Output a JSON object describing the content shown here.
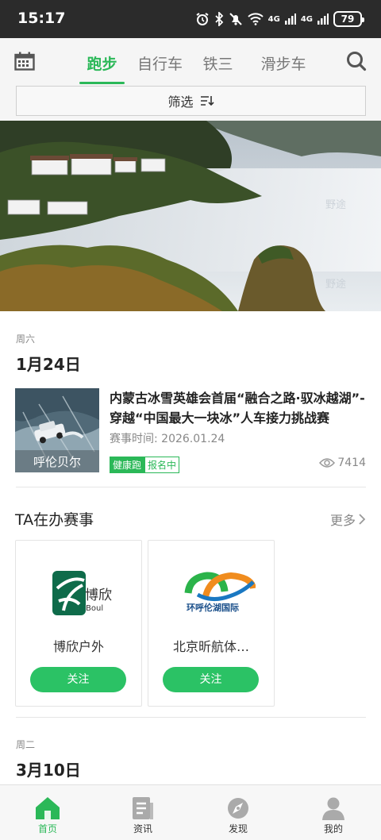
{
  "status_bar": {
    "time": "15:17",
    "battery": "79",
    "net1": "4G",
    "net2": "4G"
  },
  "top_tabs": [
    {
      "label": "跑步",
      "active": true
    },
    {
      "label": "自行车",
      "active": false
    },
    {
      "label": "铁三",
      "active": false
    },
    {
      "label": "滑步车",
      "active": false
    }
  ],
  "filter": {
    "label": "筛选"
  },
  "banner": {
    "watermark": "野途"
  },
  "day1": {
    "weekday": "周六",
    "date": "1月24日"
  },
  "event": {
    "title": "内蒙古冰雪英雄会首届“融合之路·驭冰越湖”-穿越“中国最大一块冰”人车接力挑战赛",
    "time_label": "赛事时间: ",
    "time": "2026.01.24",
    "tag1": "健康跑",
    "tag2": "报名中",
    "views": "7414",
    "thumb_caption": "呼伦贝尔"
  },
  "section": {
    "title": "TA在办赛事",
    "more": "更多"
  },
  "organizers": [
    {
      "name": "博欣户外",
      "follow": "关注",
      "logo_text": "博欣",
      "logo_sub": "Boul"
    },
    {
      "name": "北京昕航体…",
      "follow": "关注",
      "logo_text": "环呼伦湖国际",
      "logo_sub": ""
    }
  ],
  "day2": {
    "weekday": "周二",
    "date": "3月10日"
  },
  "bottom_nav": [
    {
      "label": "首页",
      "icon": "home-icon",
      "active": true
    },
    {
      "label": "资讯",
      "icon": "news-icon",
      "active": false
    },
    {
      "label": "发现",
      "icon": "discover-icon",
      "active": false
    },
    {
      "label": "我的",
      "icon": "profile-icon",
      "active": false
    }
  ],
  "colors": {
    "accent": "#2bb858",
    "status_bar": "#2b2b2b"
  }
}
